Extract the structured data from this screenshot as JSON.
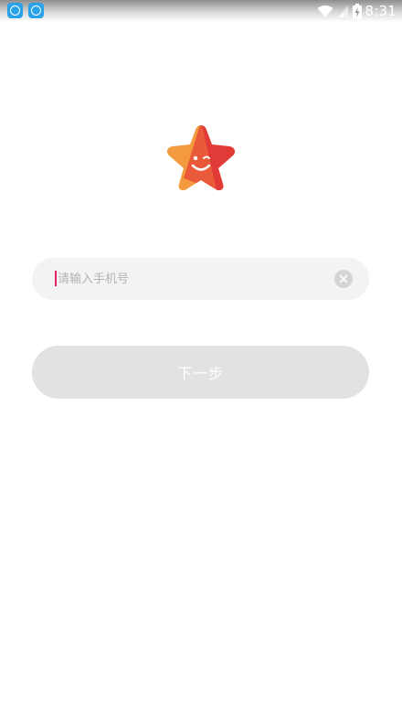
{
  "status_bar": {
    "time": "8:31",
    "notification_icons": [
      "app-notification-icon",
      "app-notification-icon"
    ],
    "wifi_icon": "wifi-icon",
    "signal_icon": "signal-icon",
    "battery_icon": "battery-charging-icon"
  },
  "logo": {
    "icon": "smiling-star-logo-icon",
    "colors": {
      "left": "#f39a3e",
      "center": "#ea5a3a",
      "right": "#e23a37"
    }
  },
  "login": {
    "phone_placeholder": "请输入手机号",
    "phone_value": "",
    "clear_icon": "clear-icon",
    "next_label": "下一步",
    "next_bg": "#e2e2e2",
    "field_bg": "#f3f3f3",
    "caret_color": "#e0245e"
  }
}
